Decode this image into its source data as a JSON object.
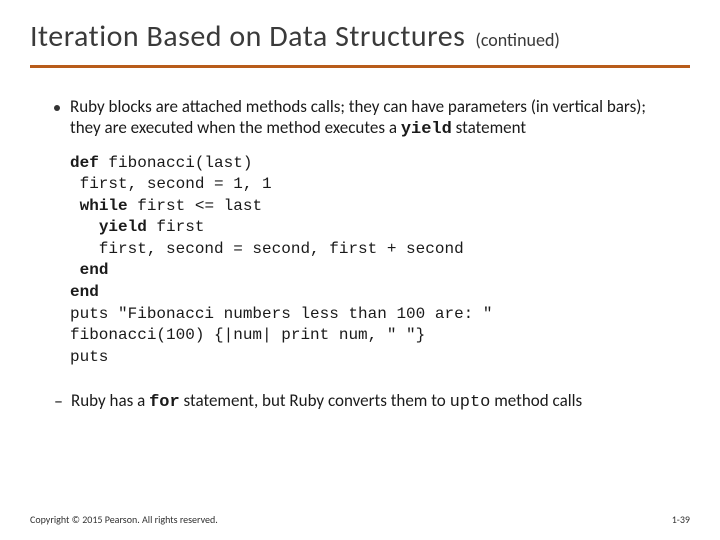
{
  "title": "Iteration Based on Data Structures",
  "subtitle": "(continued)",
  "bullet": {
    "pre": "Ruby blocks are attached methods calls; they can have parameters (in vertical bars); they are executed when the method executes a ",
    "code": "yield",
    "post": " statement"
  },
  "code": {
    "l1a": "def",
    "l1b": " fibonacci(last)",
    "l2": " first, second = 1, 1",
    "l3a": " ",
    "l3b": "while",
    "l3c": " first <= last",
    "l4a": "   ",
    "l4b": "yield",
    "l4c": " first",
    "l5": "   first, second = second, first + second",
    "l6a": " ",
    "l6b": "end",
    "l7": "end",
    "l8": "puts \"Fibonacci numbers less than 100 are: \"",
    "l9": "fibonacci(100) {|num| print num, \" \"}",
    "l10": "puts"
  },
  "sub": {
    "pre": "Ruby has a ",
    "code1": "for",
    "mid": " statement, but Ruby converts them to ",
    "code2": "upto",
    "post": " method calls"
  },
  "footer": {
    "copyright": "Copyright © 2015 Pearson. All rights reserved.",
    "page": "1-39"
  }
}
